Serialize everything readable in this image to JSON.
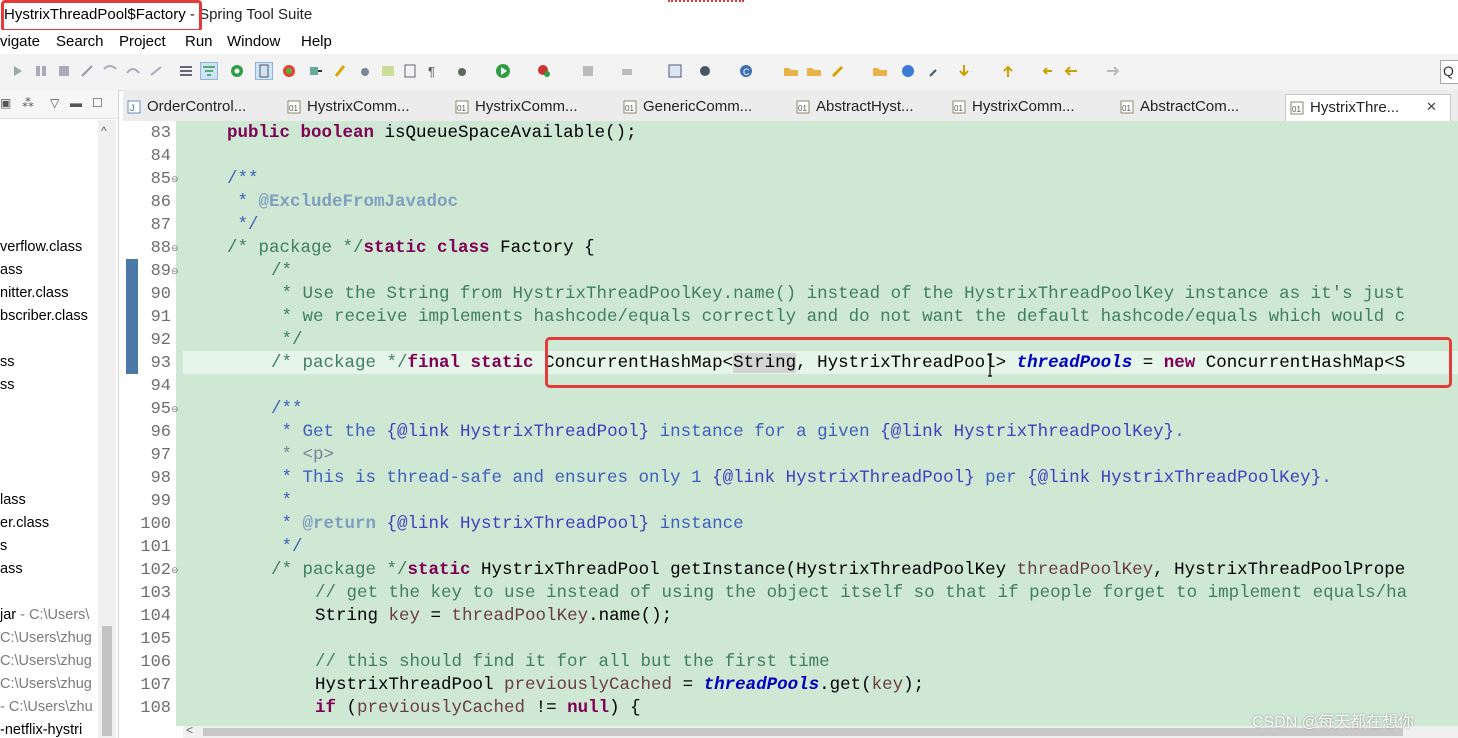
{
  "window": {
    "title_highlight": "HystrixThreadPool$Factory",
    "title_rest": " - Spring Tool Suite"
  },
  "menu": [
    "vigate",
    "Search",
    "Project",
    "Run",
    "Window",
    "Help"
  ],
  "quick_access": "Q",
  "tabs": [
    {
      "label": "OrderControl..."
    },
    {
      "label": "HystrixComm..."
    },
    {
      "label": "HystrixComm..."
    },
    {
      "label": "GenericComm..."
    },
    {
      "label": "AbstractHyst..."
    },
    {
      "label": "HystrixComm..."
    },
    {
      "label": "AbstractCom..."
    },
    {
      "label": "HystrixThre...",
      "active": true,
      "close": "✕"
    }
  ],
  "explorer": {
    "items": [
      {
        "text": "verflow.class"
      },
      {
        "text": "ass"
      },
      {
        "text": "nitter.class"
      },
      {
        "text": "bscriber.class"
      },
      {
        "text": "ss"
      },
      {
        "text": "ss"
      },
      {
        "text": "lass"
      },
      {
        "text": "er.class"
      },
      {
        "text": "s"
      },
      {
        "text": "ass"
      },
      {
        "text": "jar",
        "path": " - C:\\Users\\"
      },
      {
        "text": "",
        "path": "C:\\Users\\zhug"
      },
      {
        "text": "",
        "path": "C:\\Users\\zhug"
      },
      {
        "text": "",
        "path": "C:\\Users\\zhug"
      },
      {
        "text": "",
        "path": "- C:\\Users\\zhu"
      },
      {
        "text": "-netflix-hystri",
        "path": ""
      }
    ]
  },
  "editor": {
    "line_numbers": [
      "83",
      "84",
      "85",
      "86",
      "87",
      "88",
      "89",
      "90",
      "91",
      "92",
      "93",
      "94",
      "95",
      "96",
      "97",
      "98",
      "99",
      "100",
      "101",
      "102",
      "103",
      "104",
      "105",
      "106",
      "107",
      "108"
    ],
    "l83": {
      "kw1": "public",
      "kw2": "boolean",
      "rest": " isQueueSpaceAvailable();"
    },
    "l85": "/**",
    "l86": {
      "star": " * ",
      "tag": "@ExcludeFromJavadoc"
    },
    "l87": " */",
    "l88": {
      "cm": "/* package */",
      "kw": "static class",
      "rest": " Factory {"
    },
    "l89": "/*",
    "l90": " * Use the String from HystrixThreadPoolKey.name() instead of the HystrixThreadPoolKey instance as it's just",
    "l91": " * we receive implements hashcode/equals correctly and do not want the default hashcode/equals which would c",
    "l92": " */",
    "l93": {
      "cm": "/* package */",
      "kw": "final static",
      "t1": " ConcurrentHashMap<",
      "hl": "String",
      "t2": ", HystrixThreadPool> ",
      "fld": "threadPools",
      "t3": " = ",
      "kw2": "new",
      "t4": " ConcurrentHashMap<S"
    },
    "l95": "/**",
    "l96": {
      "a": " * Get the ",
      "l1": "{@link HystrixThreadPool}",
      "b": " instance for a given ",
      "l2": "{@link HystrixThreadPoolKey}",
      "c": "."
    },
    "l97": " * <p>",
    "l98": {
      "a": " * This is thread-safe and ensures only 1 ",
      "l1": "{@link HystrixThreadPool}",
      "b": " per ",
      "l2": "{@link HystrixThreadPoolKey}",
      "c": "."
    },
    "l99": " *",
    "l100": {
      "star": " * ",
      "tag": "@return",
      "sp": " ",
      "l1": "{@link HystrixThreadPool}",
      "b": " instance"
    },
    "l101": " */",
    "l102": {
      "cm": "/* package */",
      "kw": "static",
      "t1": " HystrixThreadPool getInstance(HystrixThreadPoolKey ",
      "v": "threadPoolKey",
      "t2": ", HystrixThreadPoolPrope"
    },
    "l103": "// get the key to use instead of using the object itself so that if people forget to implement equals/ha",
    "l104": {
      "t1": "String ",
      "v": "key",
      "t2": " = ",
      "v2": "threadPoolKey",
      "t3": ".name();"
    },
    "l106": "// this should find it for all but the first time",
    "l107": {
      "t1": "HystrixThreadPool ",
      "v": "previouslyCached",
      "t2": " = ",
      "fld": "threadPools",
      "t3": ".get(",
      "v2": "key",
      "t4": ");"
    },
    "l108": {
      "kw": "if",
      "t1": " (",
      "v": "previouslyCached",
      "t2": " != ",
      "kw2": "null",
      "t3": ") {"
    }
  },
  "watermark": "CSDN @每天都在想你",
  "colors": {
    "highlight_box": "#e53a3a",
    "code_background": "#cfe8d4",
    "keyword": "#7f0055",
    "comment": "#3f7f5f",
    "javadoc": "#3f5fbf",
    "field": "#0000c0"
  }
}
